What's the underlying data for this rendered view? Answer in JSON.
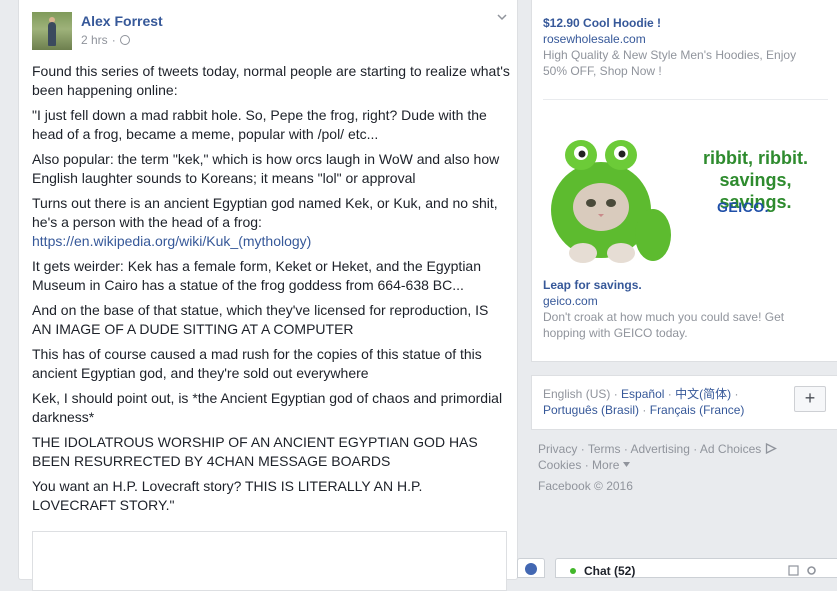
{
  "post": {
    "author": "Alex Forrest",
    "time": "2 hrs",
    "separator": "·",
    "paragraphs": [
      "Found this series of tweets today, normal people are starting to realize what's been happening online:",
      "\"I just fell down a mad rabbit hole. So, Pepe the frog, right? Dude with the head of a frog, became a meme, popular with /pol/ etc...",
      "Also popular: the term \"kek,\" which is how orcs laugh in WoW and also how English laughter sounds to Koreans; it means \"lol\" or approval",
      "Turns out there is an ancient Egyptian god named Kek, or Kuk, and no shit, he's a person with the head of a frog:",
      "It gets weirder: Kek has a female form, Keket or Heket, and the Egyptian Museum in Cairo has a statue of the frog goddess from 664-638 BC...",
      "And on the base of that statue, which they've licensed for reproduction, IS AN IMAGE OF A DUDE SITTING AT A COMPUTER",
      "This has of course caused a mad rush for the copies of this statue of this ancient Egyptian god, and they're sold out everywhere",
      "Kek, I should point out, is *the Ancient Egyptian god of chaos and primordial darkness*",
      "THE IDOLATROUS WORSHIP OF AN ANCIENT EGYPTIAN GOD HAS BEEN RESURRECTED BY 4CHAN MESSAGE BOARDS",
      "You want an H.P. Lovecraft story? THIS IS LITERALLY AN H.P. LOVECRAFT STORY.\""
    ],
    "link": "https://en.wikipedia.org/wiki/Kuk_(mythology)"
  },
  "ads": [
    {
      "title": "$12.90 Cool Hoodie !",
      "domain": "rosewholesale.com",
      "text": "High Quality & New Style Men's Hoodies, Enjoy 50% OFF, Shop Now !"
    },
    {
      "title": "Leap for savings.",
      "domain": "geico.com",
      "text": "Don't croak at how much you could save! Get hopping with GEICO today.",
      "image_line1": "ribbit, ribbit.",
      "image_line2": "savings, savings.",
      "image_brand": "GEICO.",
      "image_color": "#2e8b2e"
    }
  ],
  "languages": {
    "current": "English (US)",
    "others": [
      "Español",
      "中文(简体)",
      "Português (Brasil)",
      "Français (France)"
    ],
    "dot": "·",
    "add_label": "+"
  },
  "footer": {
    "links": [
      "Privacy",
      "Terms",
      "Advertising",
      "Ad Choices",
      "Cookies",
      "More"
    ],
    "dot": "·",
    "copyright": "Facebook © 2016"
  },
  "chat": {
    "label": "Chat (52)"
  },
  "colors": {
    "link": "#365899",
    "muted": "#90949c",
    "background": "#e9ebee"
  }
}
